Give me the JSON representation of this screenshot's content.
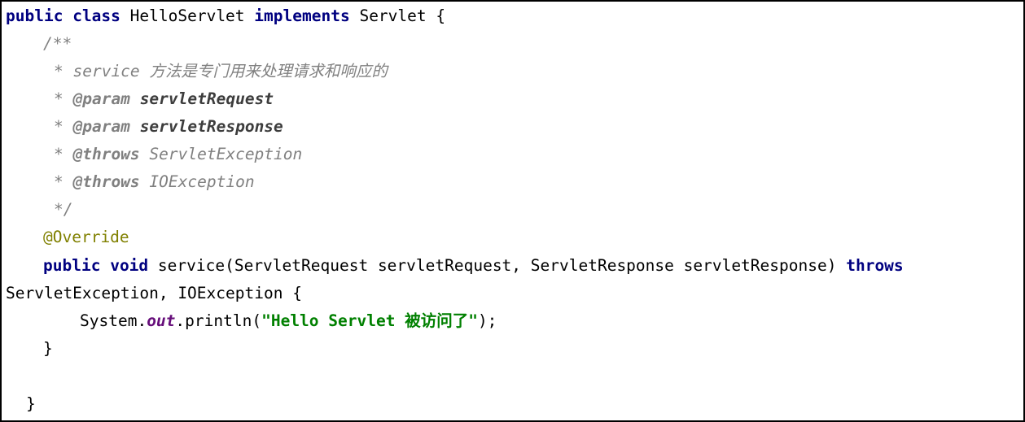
{
  "code": {
    "line1": {
      "kw_public": "public",
      "kw_class": "class",
      "class_name": "HelloServlet",
      "kw_implements": "implements",
      "interface_rest": "Servlet {"
    },
    "line2": {
      "comment": "/**"
    },
    "line3": {
      "comment": "* service 方法是专门用来处理请求和响应的"
    },
    "line4": {
      "star": "* ",
      "tag": "@param",
      "param": "servletRequest"
    },
    "line5": {
      "star": "* ",
      "tag": "@param",
      "param": "servletResponse"
    },
    "line6": {
      "star": "* ",
      "tag": "@throws",
      "rest": "ServletException"
    },
    "line7": {
      "star": "* ",
      "tag": "@throws",
      "rest": "IOException"
    },
    "line8": {
      "comment": "*/"
    },
    "line9": {
      "annotation": "@Override"
    },
    "line10": {
      "kw_public": "public",
      "kw_void": "void",
      "signature": "service(ServletRequest servletRequest, ServletResponse servletResponse)",
      "kw_throws": "throws"
    },
    "line11": {
      "text": "ServletException, IOException {"
    },
    "line12": {
      "prefix": "System.",
      "field": "out",
      "call_open": ".println(",
      "string": "\"Hello Servlet 被访问了\"",
      "call_close": ");"
    },
    "line13": {
      "text": "}"
    },
    "line15": {
      "text": "}"
    }
  },
  "colors": {
    "keyword": "#000080",
    "comment": "#808080",
    "annotation": "#808000",
    "string": "#008000",
    "static_field": "#660e7a",
    "plain": "#000000",
    "border": "#000000"
  }
}
